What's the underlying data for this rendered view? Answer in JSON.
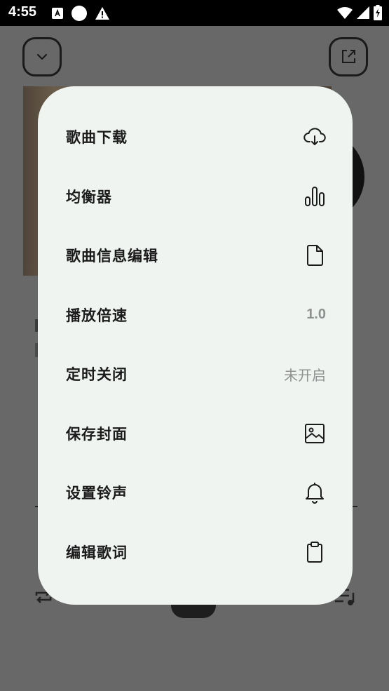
{
  "status_bar": {
    "time": "4:55"
  },
  "menu": {
    "items": [
      {
        "id": "download",
        "label": "歌曲下载",
        "icon": "cloud-download-icon"
      },
      {
        "id": "equalizer",
        "label": "均衡器",
        "icon": "equalizer-icon"
      },
      {
        "id": "edit-info",
        "label": "歌曲信息编辑",
        "icon": "file-icon"
      },
      {
        "id": "speed",
        "label": "播放倍速",
        "value": "1.0"
      },
      {
        "id": "timer",
        "label": "定时关闭",
        "value": "未开启"
      },
      {
        "id": "save-cover",
        "label": "保存封面",
        "icon": "image-icon"
      },
      {
        "id": "ringtone",
        "label": "设置铃声",
        "icon": "bell-icon"
      },
      {
        "id": "edit-lyrics",
        "label": "编辑歌词",
        "icon": "clipboard-icon"
      }
    ]
  },
  "colors": {
    "sheet_bg": "#f0f4f1",
    "label": "#1b1b1b",
    "value": "#8e918f",
    "scrim": "#686868"
  }
}
